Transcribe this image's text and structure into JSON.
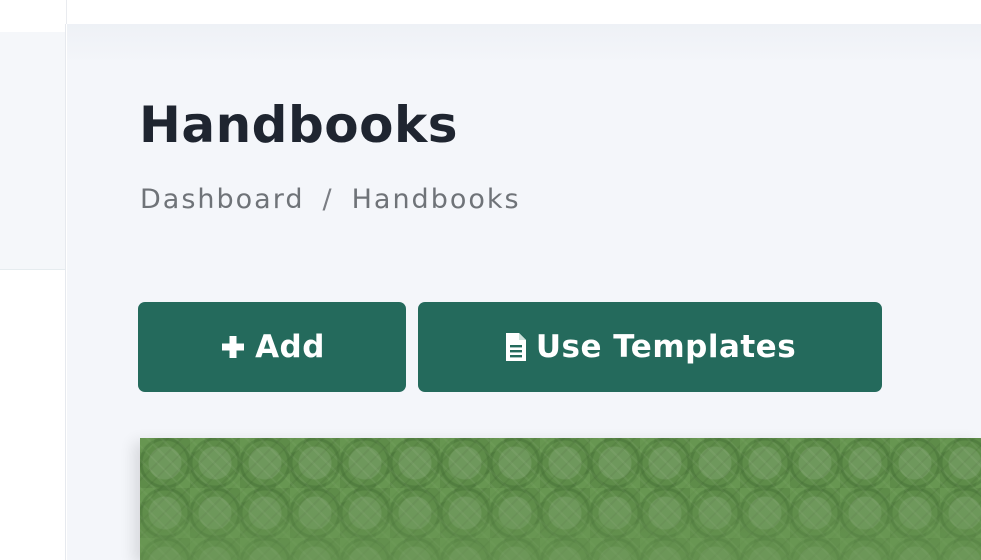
{
  "page": {
    "title": "Handbooks"
  },
  "breadcrumb": {
    "items": [
      "Dashboard",
      "Handbooks"
    ],
    "separator": "/"
  },
  "actions": {
    "add_label": "Add",
    "add_icon": "plus-icon",
    "templates_label": "Use Templates",
    "templates_icon": "file-text-icon"
  },
  "colors": {
    "button_bg": "#246a5c",
    "button_text": "#ffffff",
    "title_text": "#1f2530",
    "breadcrumb_text": "#6f7378",
    "main_bg": "#f4f6fa",
    "banner_green": "#5e8c49"
  }
}
